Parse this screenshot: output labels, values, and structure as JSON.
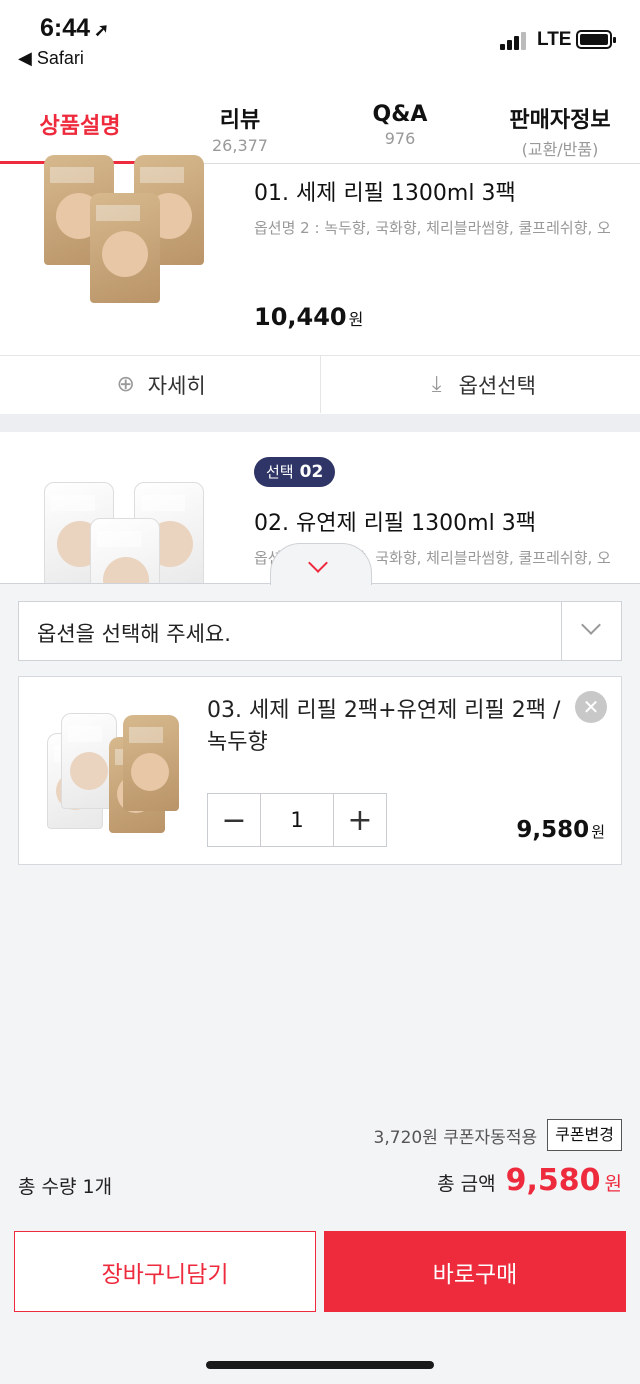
{
  "status_bar": {
    "time": "6:44",
    "back_app": "◀ Safari",
    "network": "LTE"
  },
  "tabs": [
    {
      "label": "상품설명",
      "sub": ""
    },
    {
      "label": "리뷰",
      "sub": "26,377"
    },
    {
      "label": "Q&A",
      "sub": "976"
    },
    {
      "label": "판매자정보",
      "sub": "(교환/반품)"
    }
  ],
  "products": [
    {
      "title": "01. 세제 리필 1300ml 3팩",
      "options": "옵션명 2 : 녹두향, 국화향, 체리블라썸향, 쿨프레쉬향, 오",
      "price": "10,440",
      "currency": "원",
      "detail_label": "자세히",
      "option_label": "옵션선택"
    },
    {
      "badge_label": "선택",
      "badge_num": "02",
      "title": "02. 유연제 리필 1300ml 3팩",
      "options": "옵션명 2 : 녹두향, 국화향, 체리블라썸향, 쿨프레쉬향, 오"
    }
  ],
  "sheet": {
    "select_placeholder": "옵션을 선택해 주세요.",
    "item": {
      "title": "03. 세제 리필 2팩+유연제 리필 2팩 / 녹두향",
      "qty": "1",
      "price": "9,580",
      "currency": "원"
    },
    "coupon_text": "3,720원 쿠폰자동적용",
    "coupon_button": "쿠폰변경",
    "total_qty": "총 수량 1개",
    "total_label": "총 금액",
    "total_amount": "9,580",
    "total_currency": "원",
    "cart_button": "장바구니담기",
    "buy_button": "바로구매"
  },
  "colors": {
    "accent": "#ee2a3d",
    "badge": "#2f3566"
  }
}
